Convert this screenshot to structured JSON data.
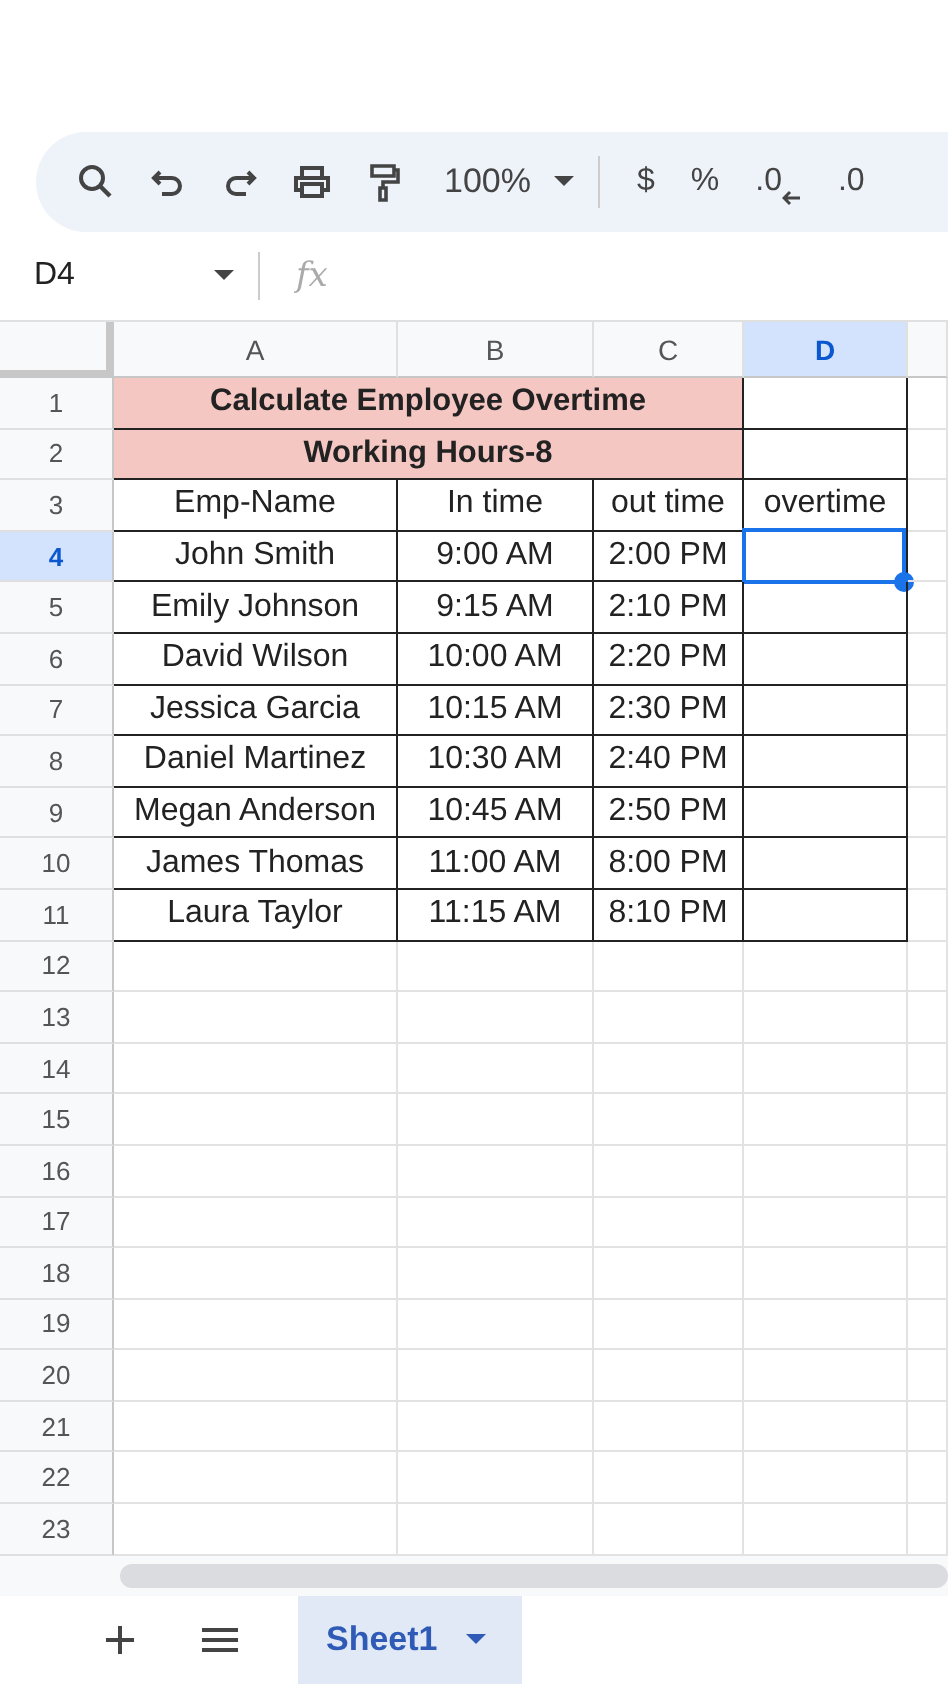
{
  "toolbar": {
    "zoom": "100%",
    "symbols": [
      "$",
      "%",
      ".0",
      ".0"
    ]
  },
  "formula_bar": {
    "name_box": "D4",
    "fx": "fx"
  },
  "columns": [
    {
      "label": "A",
      "selected": false
    },
    {
      "label": "B",
      "selected": false
    },
    {
      "label": "C",
      "selected": false
    },
    {
      "label": "D",
      "selected": true
    }
  ],
  "rows": [
    {
      "number": "1",
      "kind": "title",
      "selected": false,
      "text": "Calculate Employee Overtime"
    },
    {
      "number": "2",
      "kind": "title",
      "selected": false,
      "text": "Working Hours-8"
    },
    {
      "number": "3",
      "kind": "data",
      "selected": false,
      "cells": [
        "Emp-Name",
        "In time",
        "out time",
        "overtime"
      ]
    },
    {
      "number": "4",
      "kind": "data",
      "selected": true,
      "cells": [
        "John Smith",
        "9:00 AM",
        "2:00 PM"
      ]
    },
    {
      "number": "5",
      "kind": "data",
      "selected": false,
      "cells": [
        "Emily Johnson",
        "9:15 AM",
        "2:10 PM"
      ]
    },
    {
      "number": "6",
      "kind": "data",
      "selected": false,
      "cells": [
        "David Wilson",
        "10:00 AM",
        "2:20 PM"
      ]
    },
    {
      "number": "7",
      "kind": "data",
      "selected": false,
      "cells": [
        "Jessica Garcia",
        "10:15 AM",
        "2:30 PM"
      ]
    },
    {
      "number": "8",
      "kind": "data",
      "selected": false,
      "cells": [
        "Daniel Martinez",
        "10:30 AM",
        "2:40 PM"
      ]
    },
    {
      "number": "9",
      "kind": "data",
      "selected": false,
      "cells": [
        "Megan Anderson",
        "10:45 AM",
        "2:50 PM"
      ]
    },
    {
      "number": "10",
      "kind": "data",
      "selected": false,
      "cells": [
        "James Thomas",
        "11:00 AM",
        "8:00 PM"
      ]
    },
    {
      "number": "11",
      "kind": "data",
      "selected": false,
      "cells": [
        "Laura Taylor",
        "11:15 AM",
        "8:10 PM"
      ]
    },
    {
      "number": "12",
      "kind": "empty",
      "selected": false
    },
    {
      "number": "13",
      "kind": "empty",
      "selected": false
    },
    {
      "number": "14",
      "kind": "empty",
      "selected": false
    },
    {
      "number": "15",
      "kind": "empty",
      "selected": false
    },
    {
      "number": "16",
      "kind": "empty",
      "selected": false
    },
    {
      "number": "17",
      "kind": "empty",
      "selected": false
    },
    {
      "number": "18",
      "kind": "empty",
      "selected": false
    },
    {
      "number": "19",
      "kind": "empty",
      "selected": false
    },
    {
      "number": "20",
      "kind": "empty",
      "selected": false
    },
    {
      "number": "21",
      "kind": "empty",
      "selected": false
    },
    {
      "number": "22",
      "kind": "empty",
      "selected": false
    },
    {
      "number": "23",
      "kind": "empty",
      "selected": false
    }
  ],
  "sheet_tabs": [
    {
      "label": "Sheet1",
      "selected": true
    }
  ]
}
